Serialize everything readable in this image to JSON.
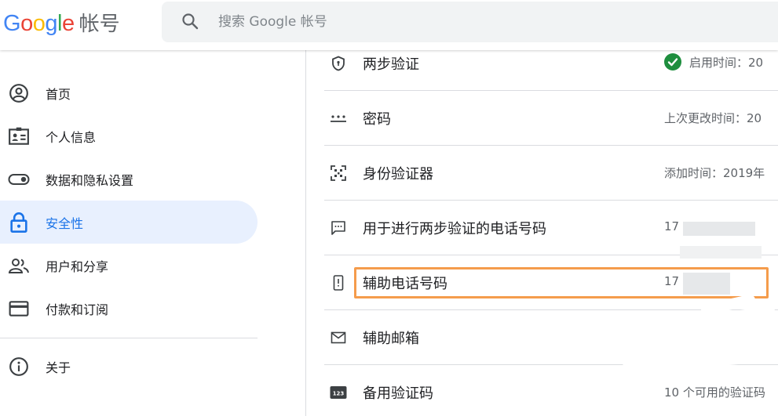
{
  "header": {
    "logo_letters": [
      {
        "char": "G",
        "color": "#4285F4"
      },
      {
        "char": "o",
        "color": "#EA4335"
      },
      {
        "char": "o",
        "color": "#FBBC05"
      },
      {
        "char": "g",
        "color": "#4285F4"
      },
      {
        "char": "l",
        "color": "#34A853"
      },
      {
        "char": "e",
        "color": "#EA4335"
      }
    ],
    "logo_product": "帐号",
    "search": {
      "placeholder": "搜索 Google 帐号",
      "value": "",
      "icon": "search-icon"
    }
  },
  "sidebar": {
    "items": [
      {
        "label": "首页",
        "icon": "account-circle-icon",
        "active": false
      },
      {
        "label": "个人信息",
        "icon": "id-card-icon",
        "active": false
      },
      {
        "label": "数据和隐私设置",
        "icon": "toggle-icon",
        "active": false
      },
      {
        "label": "安全性",
        "icon": "lock-icon",
        "active": true
      },
      {
        "label": "用户和分享",
        "icon": "people-icon",
        "active": false
      },
      {
        "label": "付款和订阅",
        "icon": "credit-card-icon",
        "active": false
      }
    ],
    "secondary_items": [
      {
        "label": "关于",
        "icon": "info-icon",
        "active": false
      }
    ]
  },
  "security_rows": [
    {
      "title": "两步验证",
      "icon": "shield-icon",
      "value": "启用时间：20",
      "status_icon": "check-circle-icon"
    },
    {
      "title": "密码",
      "icon": "password-dots-icon",
      "value": "上次更改时间：20"
    },
    {
      "title": "身份验证器",
      "icon": "qr-code-icon",
      "value": "添加时间：2019年"
    },
    {
      "title": "用于进行两步验证的电话号码",
      "icon": "sms-icon",
      "value": "17"
    },
    {
      "title": "辅助电话号码",
      "icon": "phone-icon",
      "value": "17"
    },
    {
      "title": "辅助邮箱",
      "icon": "mail-icon",
      "value": ""
    },
    {
      "title": "备用验证码",
      "icon": "backup-codes-icon",
      "value": "10 个可用的验证码"
    }
  ],
  "colors": {
    "accent": "#1a73e8",
    "active_bg": "#e8f0fe",
    "success": "#1e8e3e",
    "highlight_border": "#f59c4c",
    "divider": "#dadce0"
  }
}
